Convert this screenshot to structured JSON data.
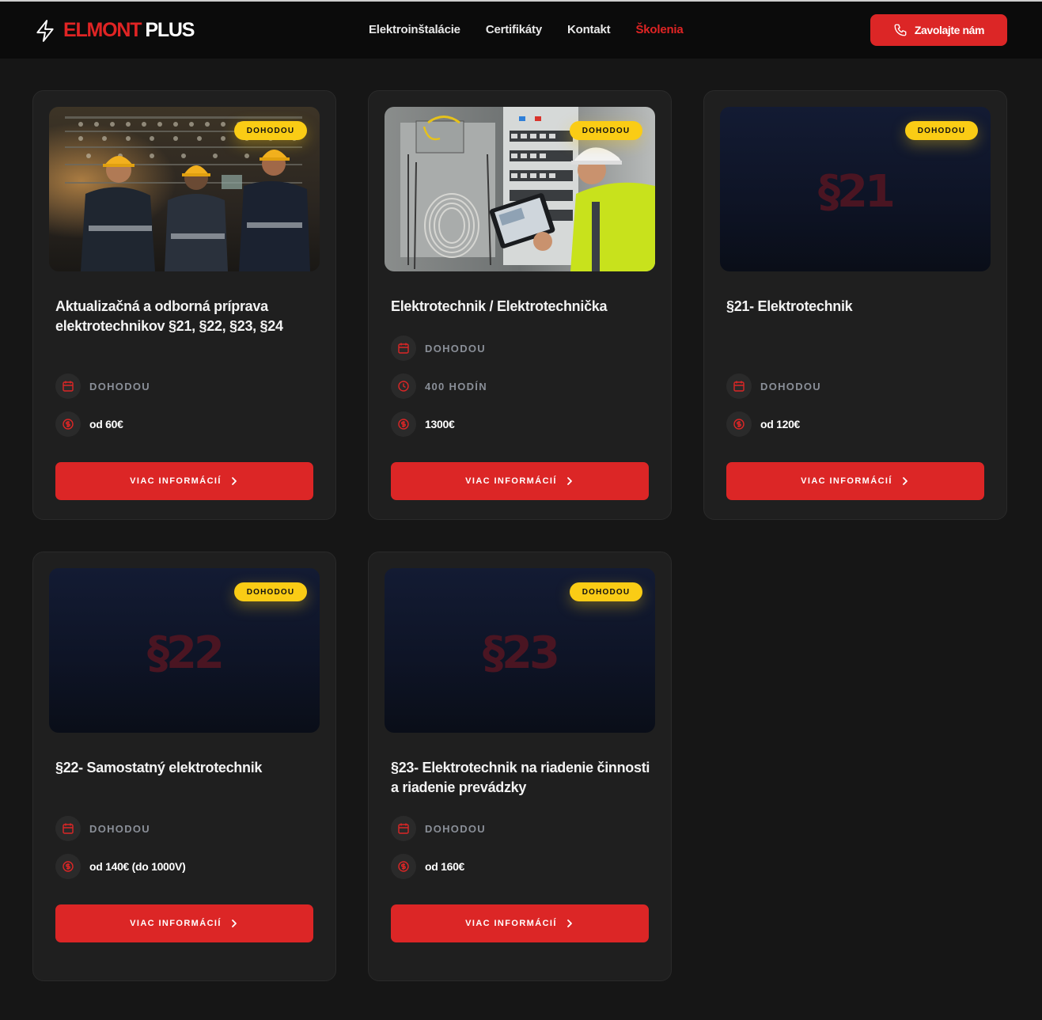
{
  "header": {
    "logo": {
      "red": "ELMONT",
      "white": "PLUS",
      "icon": "bolt-icon"
    },
    "nav": [
      {
        "label": "Elektroinštalácie",
        "active": false
      },
      {
        "label": "Certifikáty",
        "active": false
      },
      {
        "label": "Kontakt",
        "active": false
      },
      {
        "label": "Školenia",
        "active": true
      }
    ],
    "call_button": {
      "label": "Zavolajte nám",
      "icon": "phone-icon"
    }
  },
  "colors": {
    "accent_red": "#dc2626",
    "badge_yellow": "#facc15",
    "background": "#161616",
    "card": "#1f1f1f"
  },
  "cards": [
    {
      "badge": "DOHODOU",
      "image": "photo-technicians-control-panel",
      "placeholder_text": "",
      "title": "Aktualizačná a odborná príprava elektrotechnikov §21, §22, §23, §24",
      "date": "DOHODOU",
      "duration": "",
      "price": "od 60€",
      "button": "VIAC INFORMÁCIÍ"
    },
    {
      "badge": "DOHODOU",
      "image": "photo-electrician-tablet",
      "placeholder_text": "",
      "title": "Elektrotechnik / Elektrotechnička",
      "date": "DOHODOU",
      "duration": "400 HODÍN",
      "price": "1300€",
      "button": "VIAC INFORMÁCIÍ"
    },
    {
      "badge": "DOHODOU",
      "image": "",
      "placeholder_text": "§21",
      "title": "§21- Elektrotechnik",
      "date": "DOHODOU",
      "duration": "",
      "price": "od 120€",
      "button": "VIAC INFORMÁCIÍ"
    },
    {
      "badge": "DOHODOU",
      "image": "",
      "placeholder_text": "§22",
      "title": "§22- Samostatný elektrotechnik",
      "date": "DOHODOU",
      "duration": "",
      "price": "od 140€ (do 1000V)",
      "button": "VIAC INFORMÁCIÍ"
    },
    {
      "badge": "DOHODOU",
      "image": "",
      "placeholder_text": "§23",
      "title": "§23- Elektrotechnik na riadenie činnosti a riadenie prevádzky",
      "date": "DOHODOU",
      "duration": "",
      "price": "od 160€",
      "button": "VIAC INFORMÁCIÍ"
    }
  ]
}
